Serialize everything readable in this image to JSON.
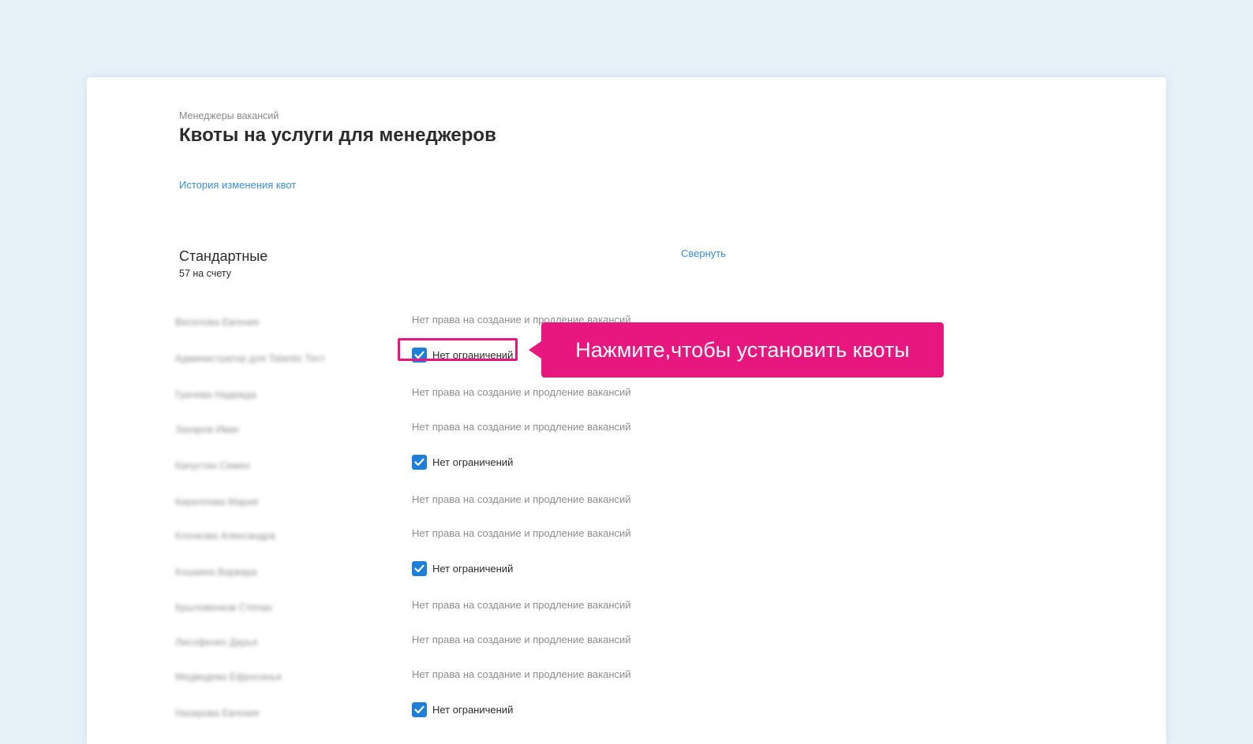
{
  "header": {
    "breadcrumb": "Менеджеры вакансий",
    "title": "Квоты на услуги для менеджеров",
    "history_link": "История изменения квот"
  },
  "section": {
    "title": "Стандартные",
    "count": "57 на счету",
    "collapse_link": "Свернуть"
  },
  "rows": [
    {
      "name": "Веселова Евгения",
      "status": "no_rights",
      "text": "Нет права на создание и продление вакансий"
    },
    {
      "name": "Администратор для Talantix Тест",
      "status": "checked",
      "text": "Нет ограничений"
    },
    {
      "name": "Грачева Надежда",
      "status": "no_rights",
      "text": "Нет права на создание и продление вакансий"
    },
    {
      "name": "Захаров Иван",
      "status": "no_rights",
      "text": "Нет права на создание и продление вакансий"
    },
    {
      "name": "Капустин Семен",
      "status": "checked",
      "text": "Нет ограничений"
    },
    {
      "name": "Кириллова Мария",
      "status": "no_rights",
      "text": "Нет права на создание и продление вакансий"
    },
    {
      "name": "Клочкова Александра",
      "status": "no_rights",
      "text": "Нет права на создание и продление вакансий"
    },
    {
      "name": "Кошкина Варвара",
      "status": "checked",
      "text": "Нет ограничений"
    },
    {
      "name": "Крыловенков Степан",
      "status": "no_rights",
      "text": "Нет права на создание и продление вакансий"
    },
    {
      "name": "Лисофенко Дарья",
      "status": "no_rights",
      "text": "Нет права на создание и продление вакансий"
    },
    {
      "name": "Медведева Ефросинья",
      "status": "no_rights",
      "text": "Нет права на создание и продление вакансий"
    },
    {
      "name": "Назарова Евгения",
      "status": "checked",
      "text": "Нет ограничений"
    }
  ],
  "callout": {
    "text": "Нажмите,чтобы установить квоты"
  },
  "colors": {
    "accent_pink": "#e8177f",
    "checkbox_blue": "#1f7fd8",
    "link_blue": "#3d8ddb"
  }
}
